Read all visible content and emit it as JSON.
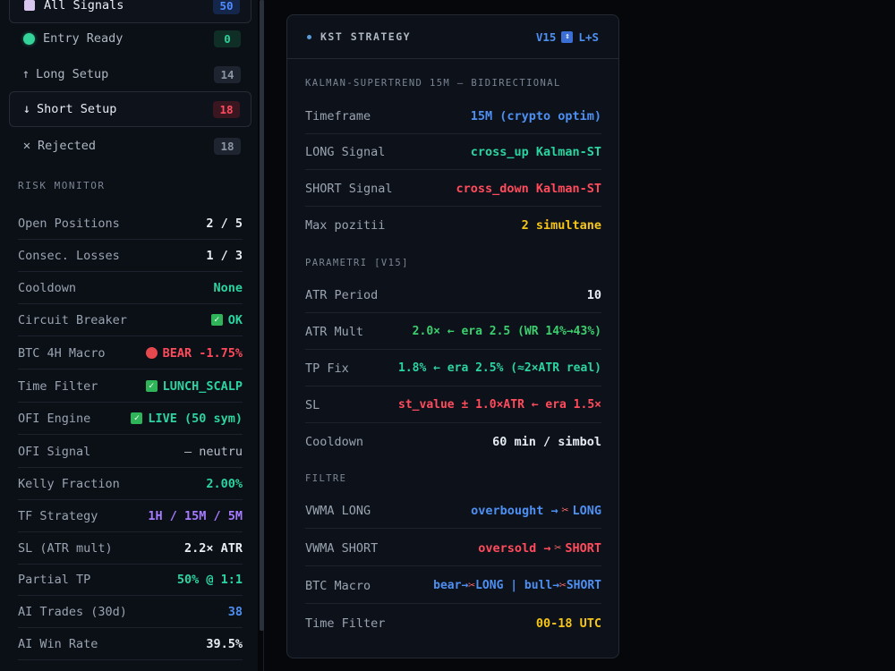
{
  "filters": {
    "all": {
      "label": "All Signals",
      "count": "50"
    },
    "entry": {
      "label": "Entry Ready",
      "count": "0"
    },
    "long": {
      "icon": "↑",
      "label": "Long Setup",
      "count": "14"
    },
    "short": {
      "icon": "↓",
      "label": "Short Setup",
      "count": "18"
    },
    "rejected": {
      "icon": "✕",
      "label": "Rejected",
      "count": "18"
    }
  },
  "risk": {
    "title": "RISK MONITOR",
    "rows": [
      {
        "label": "Open Positions",
        "value": "2 / 5"
      },
      {
        "label": "Consec. Losses",
        "value": "1 / 3"
      },
      {
        "label": "Cooldown",
        "value": "None"
      },
      {
        "label": "Circuit Breaker",
        "value": "OK"
      },
      {
        "label": "BTC 4H Macro",
        "value": "BEAR -1.75%"
      },
      {
        "label": "Time Filter",
        "value": "LUNCH_SCALP"
      },
      {
        "label": "OFI Engine",
        "value": "LIVE (50 sym)"
      },
      {
        "label": "OFI Signal",
        "value": "— neutru"
      },
      {
        "label": "Kelly Fraction",
        "value": "2.00%"
      },
      {
        "label": "TF Strategy",
        "value": "1H / 15M / 5M"
      },
      {
        "label": "SL (ATR mult)",
        "value": "2.2× ATR"
      },
      {
        "label": "Partial TP",
        "value": "50% @ 1:1"
      },
      {
        "label": "AI Trades (30d)",
        "value": "38"
      },
      {
        "label": "AI Win Rate",
        "value": "39.5%"
      }
    ]
  },
  "strategy": {
    "title": "KST STRATEGY",
    "version": "V15",
    "mode": "L+S",
    "subtitle": "KALMAN-SUPERTREND 15M — BIDIRECTIONAL",
    "rows": [
      {
        "label": "Timeframe",
        "value": "15M (crypto optim)"
      },
      {
        "label": "LONG Signal",
        "value": "cross_up Kalman-ST"
      },
      {
        "label": "SHORT Signal",
        "value": "cross_down Kalman-ST"
      },
      {
        "label": "Max pozitii",
        "value": "2 simultane"
      }
    ],
    "params_title": "PARAMETRI [V15]",
    "params": [
      {
        "label": "ATR Period",
        "value": "10"
      },
      {
        "label": "ATR Mult",
        "value": "2.0× ← era 2.5 (WR 14%→43%)"
      },
      {
        "label": "TP Fix",
        "value": "1.8% ← era 2.5% (≈2×ATR real)"
      },
      {
        "label": "SL",
        "value": "st_value ± 1.0×ATR ← era 1.5×"
      },
      {
        "label": "Cooldown",
        "value": "60 min / simbol"
      }
    ],
    "filters_title": "FILTRE",
    "filters": [
      {
        "label": "VWMA LONG",
        "value_pre": "overbought →",
        "value_post": "LONG"
      },
      {
        "label": "VWMA SHORT",
        "value_pre": "oversold →",
        "value_post": "SHORT"
      },
      {
        "label": "BTC Macro",
        "value_a": "bear→",
        "value_b": "LONG | bull→",
        "value_c": "SHORT"
      },
      {
        "label": "Time Filter",
        "value": "00-18 UTC"
      }
    ]
  },
  "colors": {
    "accent": "#4e8ff2",
    "green": "#2bd4a0",
    "red": "#ff4b5c",
    "yellow": "#f5c518",
    "purple": "#a77bff"
  }
}
